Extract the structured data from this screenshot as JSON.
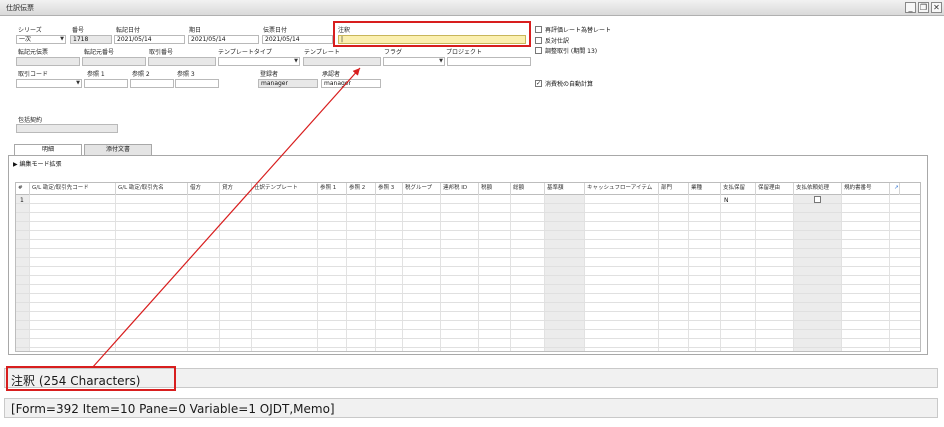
{
  "window": {
    "title": "仕訳伝票"
  },
  "fields": {
    "series_label": "シリーズ",
    "series_value": "一次",
    "number_label": "番号",
    "number_value": "1718",
    "posting_date_label": "転記日付",
    "posting_date_value": "2021/05/14",
    "due_date_label": "期日",
    "due_date_value": "2021/05/14",
    "doc_date_label": "伝票日付",
    "doc_date_value": "2021/05/14",
    "remarks_label": "注釈",
    "remarks_value": "|",
    "origin_doc_label": "転記元伝票",
    "origin_no_label": "転記元番号",
    "trans_no_label": "取引番号",
    "template_type_label": "テンプレートタイプ",
    "template_label": "テンプレート",
    "flag_label": "フラグ",
    "project_label": "プロジェクト",
    "trans_code_label": "取引コード",
    "ref1_label": "参照 1",
    "ref2_label": "参照 2",
    "ref3_label": "参照 3",
    "creator_label": "登録者",
    "creator_value": "manager",
    "approver_label": "承認者",
    "approver_value": "manager",
    "agreement_label": "包括契約"
  },
  "checkboxes": {
    "revaluation": "再評価レート為替レート",
    "reversal": "反対仕訳",
    "adjustment": "調整取引 (期間 13)",
    "auto_tax": "消費税の自動計算"
  },
  "tabs": [
    "明細",
    "添付文書"
  ],
  "edit_mode": "編集モード拡張",
  "grid": {
    "headers": [
      "#",
      "G/L 勘定/取引先コード",
      "G/L 勘定/取引先名",
      "借方",
      "貸方",
      "仕訳テンプレート",
      "参照 1",
      "参照 2",
      "参照 3",
      "税グループ",
      "連邦税 ID",
      "税額",
      "総額",
      "基準額",
      "キャッシュフローアイテム",
      "部門",
      "業種",
      "支払保留",
      "保留理由",
      "支払依頼処理",
      "規約書番号"
    ],
    "row1_num": "1",
    "row1_hold": "N"
  },
  "status": {
    "field_info": "注釈 (254 Characters)",
    "form_info": "[Form=392 Item=10 Pane=0 Variable=1 OJDT,Memo]"
  },
  "colors": {
    "highlight": "#d81e1e",
    "remarks_bg": "#fbf0b0"
  }
}
